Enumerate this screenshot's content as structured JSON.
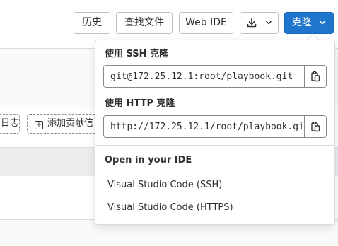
{
  "toolbar": {
    "history_label": "历史",
    "find_file_label": "查找文件",
    "web_ide_label": "Web IDE",
    "clone_label": "克隆"
  },
  "background": {
    "log_button_partial": "日志",
    "add_contributing_partial": "添加贡献信"
  },
  "clone_dropdown": {
    "ssh_label": "使用 SSH 克隆",
    "ssh_url": "git@172.25.12.1:root/playbook.git",
    "http_label": "使用 HTTP 克隆",
    "http_url": "http://172.25.12.1/root/playbook.git",
    "ide_heading": "Open in your IDE",
    "ide_items": [
      "Visual Studio Code (SSH)",
      "Visual Studio Code (HTTPS)"
    ]
  },
  "colors": {
    "primary": "#1f75cb",
    "border": "#bfbfc3",
    "text": "#303030"
  },
  "icons": {
    "download": "download-icon",
    "chevron": "chevron-down-icon",
    "copy": "copy-icon"
  }
}
